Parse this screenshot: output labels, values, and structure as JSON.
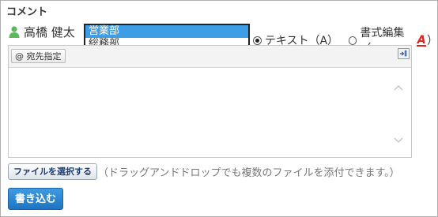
{
  "comment": {
    "heading": "コメント",
    "user": {
      "icon": "person-icon",
      "name": "高橋 健太"
    },
    "department_dropdown": {
      "options": [
        "営業部",
        "総務部"
      ],
      "selected": "営業部",
      "highlight_color": "#3d9ee6"
    },
    "format_mode": {
      "options": [
        {
          "label": "テキスト（A）",
          "checked": true
        },
        {
          "label": "書式編集（",
          "checked": false
        }
      ],
      "format_icon_letter": "A",
      "format_icon_close": "）"
    },
    "editor": {
      "mention_button": "@ 宛先指定",
      "body_text": ""
    },
    "attachments": {
      "select_button": "ファイルを選択する",
      "hint": "（ドラッグアンドドロップでも複数のファイルを添付できます。）"
    },
    "submit_button": "書き込む",
    "colors": {
      "accent": "#1f74c2",
      "format_red": "#e0201b"
    }
  }
}
